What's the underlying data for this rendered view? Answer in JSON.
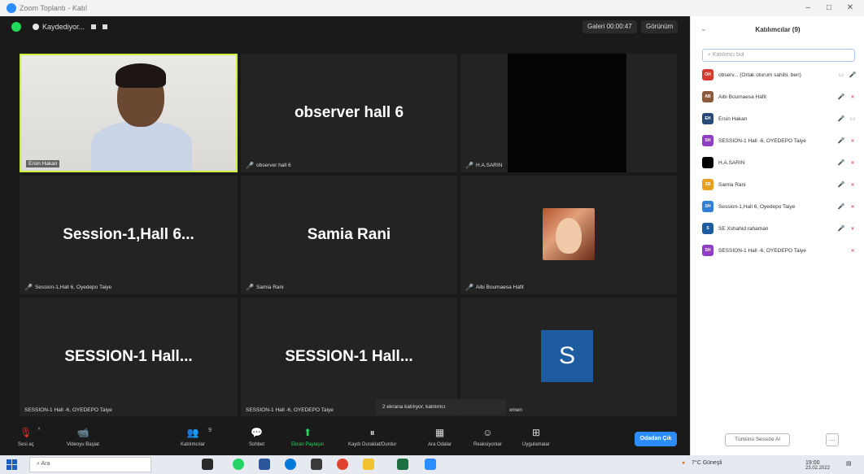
{
  "window": {
    "title": "Zoom Toplantı - Katıl",
    "minimize": "–",
    "maximize": "□",
    "close": "✕"
  },
  "topbar": {
    "recording_label": "Kaydediyor...",
    "exit_fullscreen": "Galeri 00:00:47",
    "view": "Görünüm"
  },
  "tiles": [
    {
      "label": "Ersin Hakan",
      "big": ""
    },
    {
      "label": "observer hall 6",
      "big": "observer hall 6"
    },
    {
      "label": "H.A.SARIN",
      "big": ""
    },
    {
      "label": "Session-1,Hall 6, Oyedepo Taiye",
      "big": "Session-1,Hall 6..."
    },
    {
      "label": "Samia Rani",
      "big": "Samia Rani"
    },
    {
      "label": "Aibi Boumaesa Hafit",
      "big": ""
    },
    {
      "label": "SESSION-1 Hall -6, OYEDEPO Taiye",
      "big": "SESSION-1 Hall..."
    },
    {
      "label": "SESSION-1 Hall -6, OYEDEPO Taiye",
      "big": "SESSION-1 Hall..."
    },
    {
      "label": "xmen",
      "big": "",
      "avatar": "S"
    }
  ],
  "toast": "2 ekrana katılıyor, katılımcı",
  "toolbar": {
    "items": [
      {
        "icon": "mic-icon",
        "glyph": "🎙",
        "label": "Sesi aç"
      },
      {
        "icon": "video-icon",
        "glyph": "📹",
        "label": "Videoyu Başlat"
      },
      {
        "icon": "participants-icon",
        "glyph": "👥",
        "label": "Katılımcılar",
        "badge": "9"
      },
      {
        "icon": "chat-icon",
        "glyph": "💬",
        "label": "Sohbet"
      },
      {
        "icon": "share-icon",
        "glyph": "⬆",
        "label": "Ekran Paylaşın"
      },
      {
        "icon": "record-icon",
        "glyph": "⏸",
        "label": "Kaydı Duraklat/Durdur"
      },
      {
        "icon": "breakout-icon",
        "glyph": "▦",
        "label": "Ara Odalar"
      },
      {
        "icon": "reactions-icon",
        "glyph": "☺",
        "label": "Reaksiyonlar"
      },
      {
        "icon": "apps-icon",
        "glyph": "⊞",
        "label": "Uygulamalar"
      }
    ],
    "leave": "Odadan Çık"
  },
  "panel": {
    "title": "Katılımcılar (9)",
    "search_placeholder": "Katılımcı bul",
    "participants": [
      {
        "initials": "OH",
        "color": "#d6392d",
        "name": "observ... (Ortak oturum sahibi, ben)",
        "mic": "🎤",
        "cam": "✕"
      },
      {
        "initials": "AB",
        "color": "#8b5a3c",
        "name": "Aibi Boumaesa Hafit",
        "mic": "🎤",
        "cam": "✕"
      },
      {
        "initials": "EH",
        "color": "#274a78",
        "name": "Ersin Hakan",
        "mic": "🎤",
        "cam": "▭"
      },
      {
        "initials": "SH",
        "color": "#8e3fc6",
        "name": "SESSION-1 Hall -6, OYEDEPO Taiye",
        "mic": "🎤",
        "cam": "✕"
      },
      {
        "initials": "",
        "color": "#000000",
        "name": "H.A.SARIN",
        "mic": "🎤",
        "cam": "✕"
      },
      {
        "initials": "SR",
        "color": "#e9a020",
        "name": "Samia Rani",
        "mic": "🎤",
        "cam": "✕"
      },
      {
        "initials": "SH",
        "color": "#2f7ed8",
        "name": "Session-1,Hall 6, Oyedepo Taiye",
        "mic": "🎤",
        "cam": "✕"
      },
      {
        "initials": "S",
        "color": "#1e5ca0",
        "name": "SE Xshahid rahaman",
        "mic": "🎤",
        "cam": "✕"
      },
      {
        "initials": "SH",
        "color": "#8e3fc6",
        "name": "SESSION-1 Hall -6, OYEDEPO Taiye",
        "mic": "",
        "cam": "✕"
      }
    ],
    "mute_all": "Tümünü Sessize Al",
    "more": "…"
  },
  "taskbar": {
    "search": "Ara",
    "weather": "7°C Güneşli",
    "time": "19:00",
    "date": "23.02.2022"
  }
}
